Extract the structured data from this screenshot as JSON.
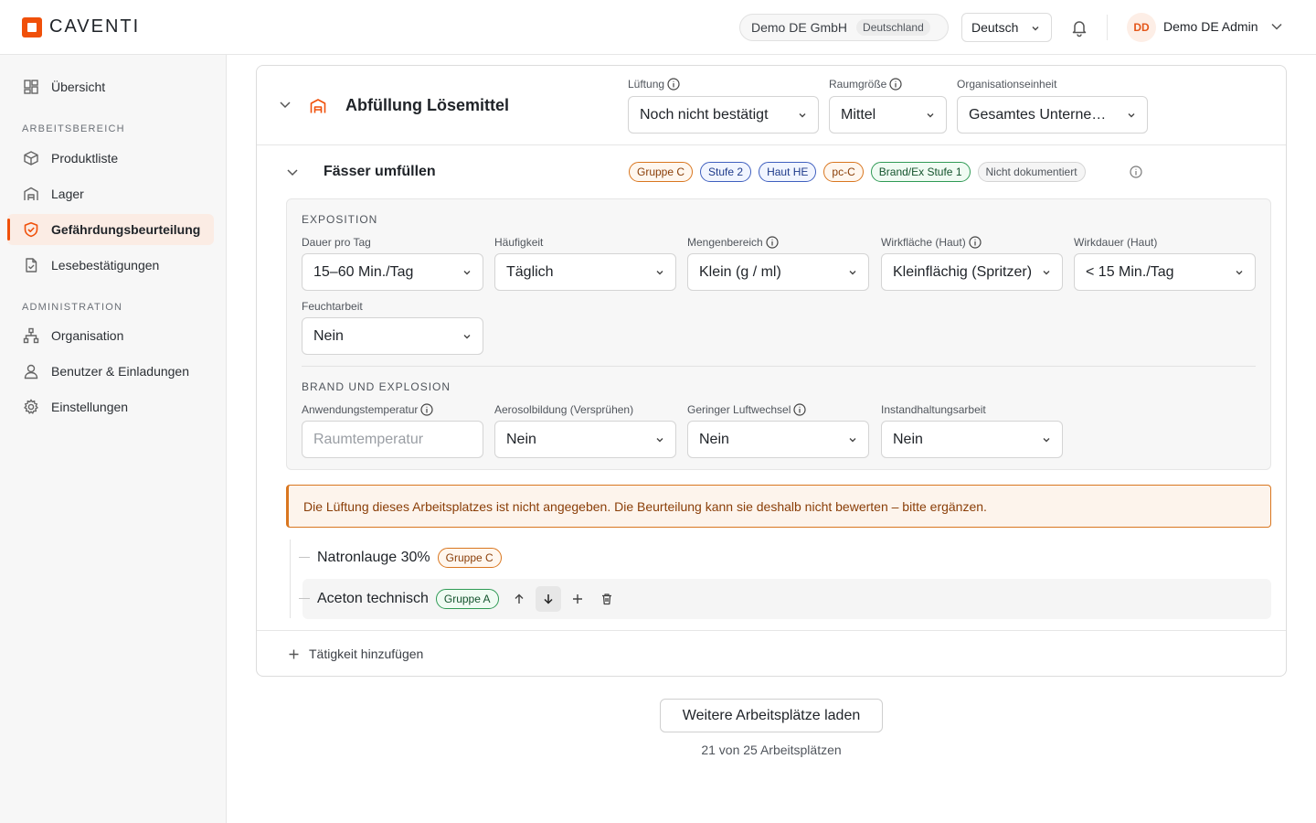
{
  "brand": {
    "name": "CAVENTI",
    "accent": "#f0500a"
  },
  "header": {
    "company": "Demo DE GmbH",
    "country": "Deutschland",
    "language": "Deutsch",
    "avatar_initials": "DD",
    "user_name": "Demo DE Admin"
  },
  "sidebar": {
    "overview": "Übersicht",
    "section_work": "ARBEITSBEREICH",
    "products": "Produktliste",
    "storage": "Lager",
    "risk": "Gefährdungsbeurteilung",
    "confirmations": "Lesebestätigungen",
    "section_admin": "ADMINISTRATION",
    "organisation": "Organisation",
    "users": "Benutzer & Einladungen",
    "settings": "Einstellungen"
  },
  "workplace": {
    "title": "Abfüllung Lösemittel",
    "ventilation_label": "Lüftung",
    "ventilation_value": "Noch nicht bestätigt",
    "room_label": "Raumgröße",
    "room_value": "Mittel",
    "org_label": "Organisationseinheit",
    "org_value": "Gesamtes Unternehmen"
  },
  "activity": {
    "title": "Fässer umfüllen",
    "badges": [
      "Gruppe C",
      "Stufe 2",
      "Haut HE",
      "pc-C",
      "Brand/Ex Stufe 1",
      "Nicht dokumentiert"
    ]
  },
  "exposure": {
    "section": "EXPOSITION",
    "duration_label": "Dauer pro Tag",
    "duration_value": "15–60 Min./Tag",
    "frequency_label": "Häufigkeit",
    "frequency_value": "Täglich",
    "amount_label": "Mengenbereich",
    "amount_value": "Klein (g / ml)",
    "skin_area_label": "Wirkfläche (Haut)",
    "skin_area_value": "Kleinflächig (Spritzer)",
    "skin_duration_label": "Wirkdauer (Haut)",
    "skin_duration_value": "< 15 Min./Tag",
    "wet_label": "Feuchtarbeit",
    "wet_value": "Nein"
  },
  "fire": {
    "section": "BRAND UND EXPLOSION",
    "temp_label": "Anwendungstemperatur",
    "temp_placeholder": "Raumtemperatur",
    "aerosol_label": "Aerosolbildung (Versprühen)",
    "aerosol_value": "Nein",
    "air_label": "Geringer Luftwechsel",
    "air_value": "Nein",
    "maint_label": "Instandhaltungsarbeit",
    "maint_value": "Nein"
  },
  "warning": "Die Lüftung dieses Arbeitsplatzes ist nicht angegeben. Die Beurteilung kann sie deshalb nicht bewerten – bitte ergänzen.",
  "products": [
    {
      "name": "Natronlauge 30%",
      "group": "Gruppe C"
    },
    {
      "name": "Aceton technisch",
      "group": "Gruppe A"
    }
  ],
  "add_activity": "Tätigkeit hinzufügen",
  "load_more": "Weitere Arbeitsplätze laden",
  "load_count": "21 von 25 Arbeitsplätzen"
}
